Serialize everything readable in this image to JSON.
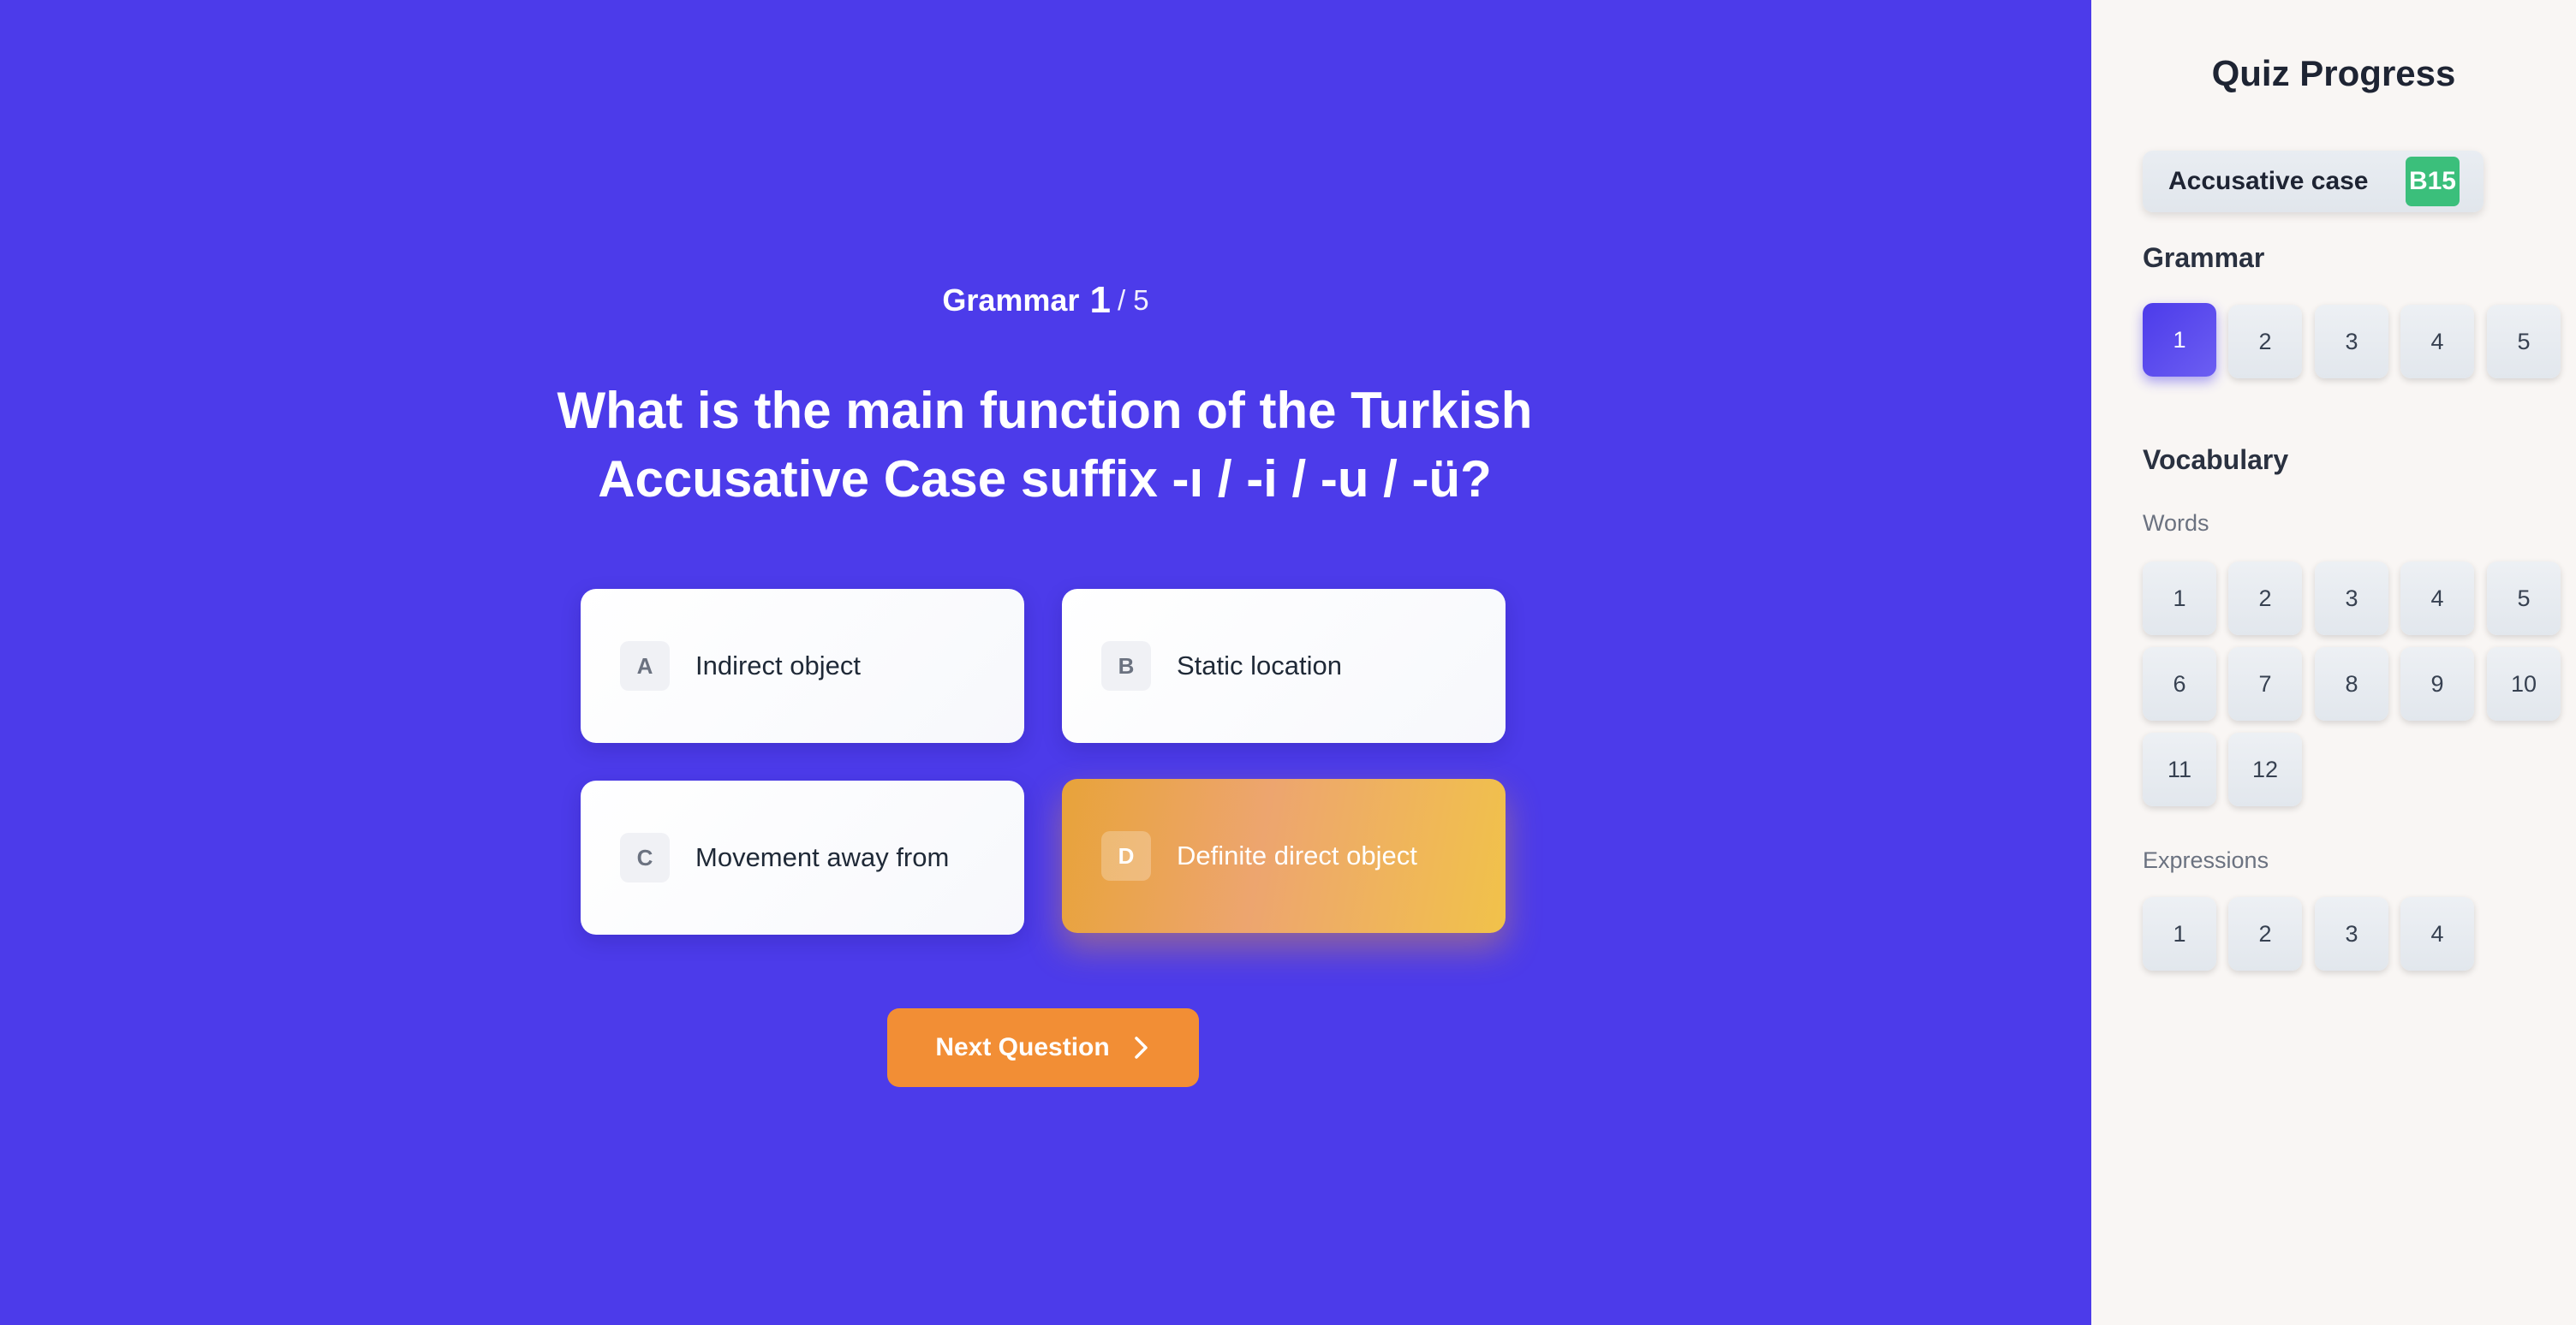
{
  "quiz": {
    "category": "Grammar",
    "current": "1",
    "total": "/ 5",
    "question": "What is the main function of the Turkish Accusative Case suffix -ı / -i / -u / -ü?",
    "options": [
      {
        "letter": "A",
        "text": "Indirect object",
        "selected": false
      },
      {
        "letter": "B",
        "text": "Static location",
        "selected": false
      },
      {
        "letter": "C",
        "text": "Movement away from",
        "selected": false
      },
      {
        "letter": "D",
        "text": "Definite direct object",
        "selected": true
      }
    ],
    "next_label": "Next Question",
    "next_icon": "chevron-right-icon"
  },
  "sidebar": {
    "title": "Quiz Progress",
    "topic": {
      "name": "Accusative case",
      "badge": "B15",
      "badge_color": "#3bbf7b"
    },
    "grammar": {
      "label": "Grammar",
      "items": [
        "1",
        "2",
        "3",
        "4",
        "5"
      ],
      "active": "1"
    },
    "vocabulary": {
      "label": "Vocabulary",
      "words": {
        "label": "Words",
        "items": [
          "1",
          "2",
          "3",
          "4",
          "5",
          "6",
          "7",
          "8",
          "9",
          "10",
          "11",
          "12"
        ]
      },
      "expressions": {
        "label": "Expressions",
        "items": [
          "1",
          "2",
          "3",
          "4"
        ]
      }
    }
  },
  "colors": {
    "main_bg": "#4c3bea",
    "selected_option": "#eda56f",
    "next_button": "#f28e35",
    "sidebar_bg": "#f9f6f4"
  }
}
